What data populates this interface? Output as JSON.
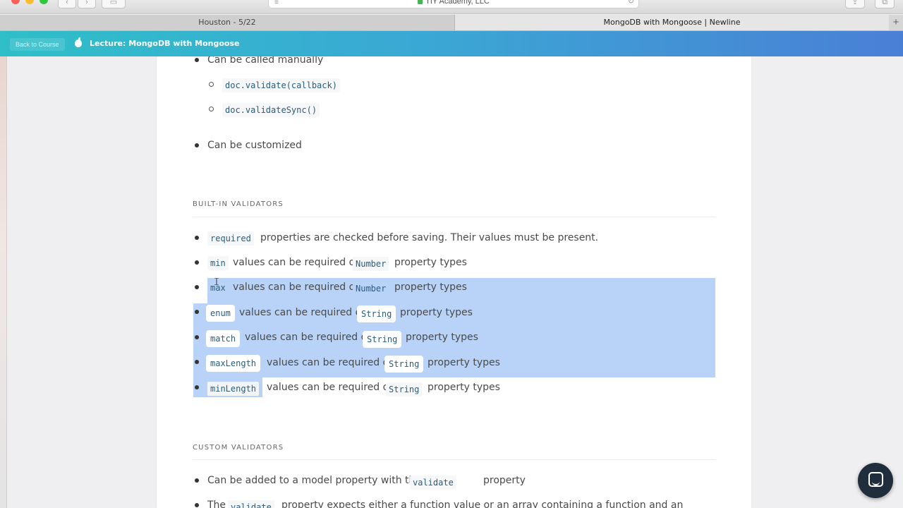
{
  "browser": {
    "url_text": "TIY Academy, LLC",
    "tabs": [
      "Houston - 5/22",
      "MongoDB with Mongoose | Newline"
    ],
    "new_tab": "+"
  },
  "course_bar": {
    "back_label": "Back to Course",
    "lecture_title": "Lecture: MongoDB with Mongoose"
  },
  "content": {
    "manual": {
      "text": "Can be called manually",
      "methods": [
        "doc.validate(callback)",
        "doc.validateSync()"
      ]
    },
    "customized": "Can be customized",
    "builtin_heading": "BUILT-IN VALIDATORS",
    "builtin": [
      {
        "code": "required",
        "text": "properties are checked before saving. Their values must be present."
      },
      {
        "code": "min",
        "text": "values can be required of",
        "type": "Number",
        "tail": "property types"
      },
      {
        "code": "max",
        "text": "values can be required of",
        "type": "Number",
        "tail": "property types"
      },
      {
        "code": "enum",
        "text": "values can be required of",
        "type": "String",
        "tail": "property types"
      },
      {
        "code": "match",
        "text": "values can be required of",
        "type": "String",
        "tail": "property types"
      },
      {
        "code": "maxLength",
        "text": "values can be required of",
        "type": "String",
        "tail": "property types"
      },
      {
        "code": "minLength",
        "text": "values can be required of",
        "type": "String",
        "tail": "property types"
      }
    ],
    "custom_heading": "CUSTOM VALIDATORS",
    "custom": [
      {
        "pre": "Can be added to a model property with the",
        "code": "validate",
        "post": "property"
      },
      {
        "pre": "The",
        "code": "validate",
        "post": "property expects either a function value or an array containing a function and an"
      }
    ]
  },
  "colors": {
    "selection": "#b8d3f7",
    "code_text": "#2b5d7d",
    "header_gradient_start": "#2fbfc8",
    "header_gradient_end": "#4a7fd6"
  },
  "icons": [
    "apple-icon",
    "chat-icon",
    "reload-icon",
    "lock-icon"
  ]
}
